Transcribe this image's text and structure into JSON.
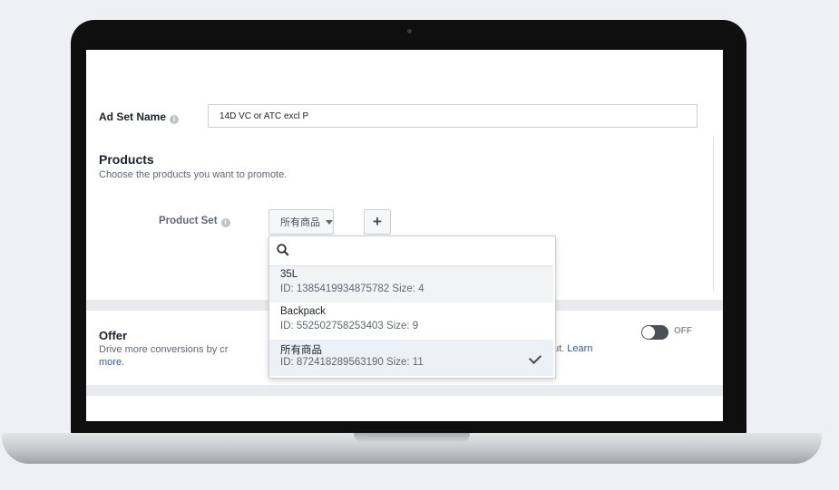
{
  "adset": {
    "label": "Ad Set Name",
    "value": "14D VC or ATC excl P"
  },
  "products": {
    "title": "Products",
    "subtitle": "Choose the products you want to promote.",
    "product_set_label": "Product Set",
    "selected": "所有商品",
    "add_label": "+"
  },
  "dropdown": {
    "search_placeholder": "",
    "options": [
      {
        "name": "35L",
        "meta": "ID: 1385419934875782 Size: 4"
      },
      {
        "name": "Backpack",
        "meta": "ID: 552502758253403 Size: 9"
      },
      {
        "name": "所有商品",
        "meta": "ID: 872418289563190 Size: 11",
        "selected": true
      }
    ]
  },
  "offer": {
    "title": "Offer",
    "desc_start": "Drive more conversions by cr",
    "desc_end": "ut.",
    "learn": "Learn",
    "more": "more.",
    "toggle_label": "OFF"
  },
  "colors": {
    "link": "#365899",
    "toggle_off": "#4b4f56",
    "band": "#e9ebee"
  }
}
